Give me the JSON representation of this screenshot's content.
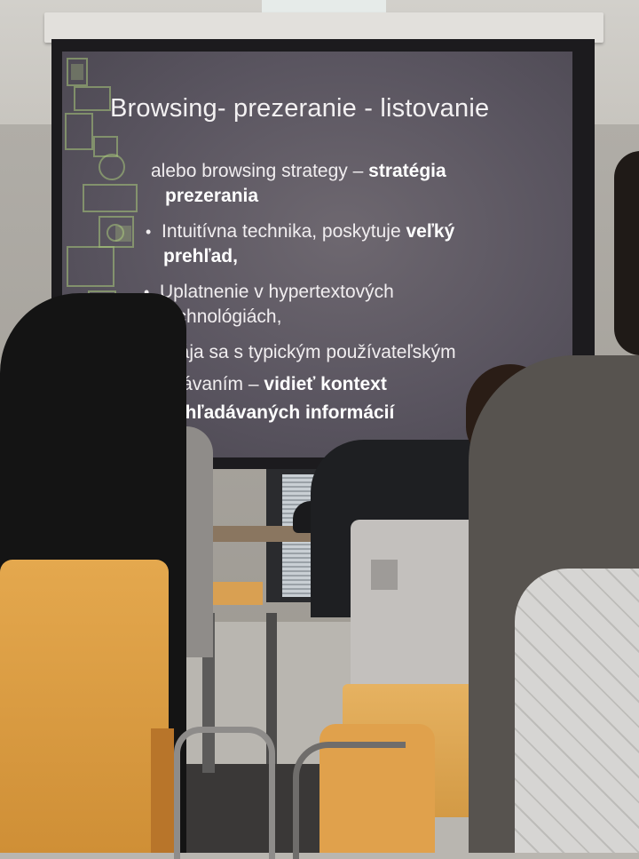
{
  "slide": {
    "title": "Browsing- prezeranie - listovanie",
    "intro": {
      "text": "alebo browsing strategy – ",
      "bold": "stratégia",
      "bold_line2": "prezerania"
    },
    "bullets": [
      {
        "glyph": "•",
        "line1_text": "Intuitívna technika, poskytuje ",
        "line1_bold": "veľký",
        "line2_bold": "prehľad,"
      },
      {
        "glyph": "•",
        "line1_text": "Uplatnenie v hypertextových",
        "line2_text": "technológiách,"
      },
      {
        "glyph": "•",
        "line1_text": "Spája sa s typickým používateľským",
        "line2_text": "správaním – ",
        "line2_bold": "vidieť kontext",
        "line3_bold": "prehľadávaných informácií"
      }
    ]
  },
  "colors": {
    "slide_bg": "#5a5560",
    "slide_text": "#f1eef0",
    "chair": "#e0a14c",
    "deco_green": "#a8c77a"
  }
}
